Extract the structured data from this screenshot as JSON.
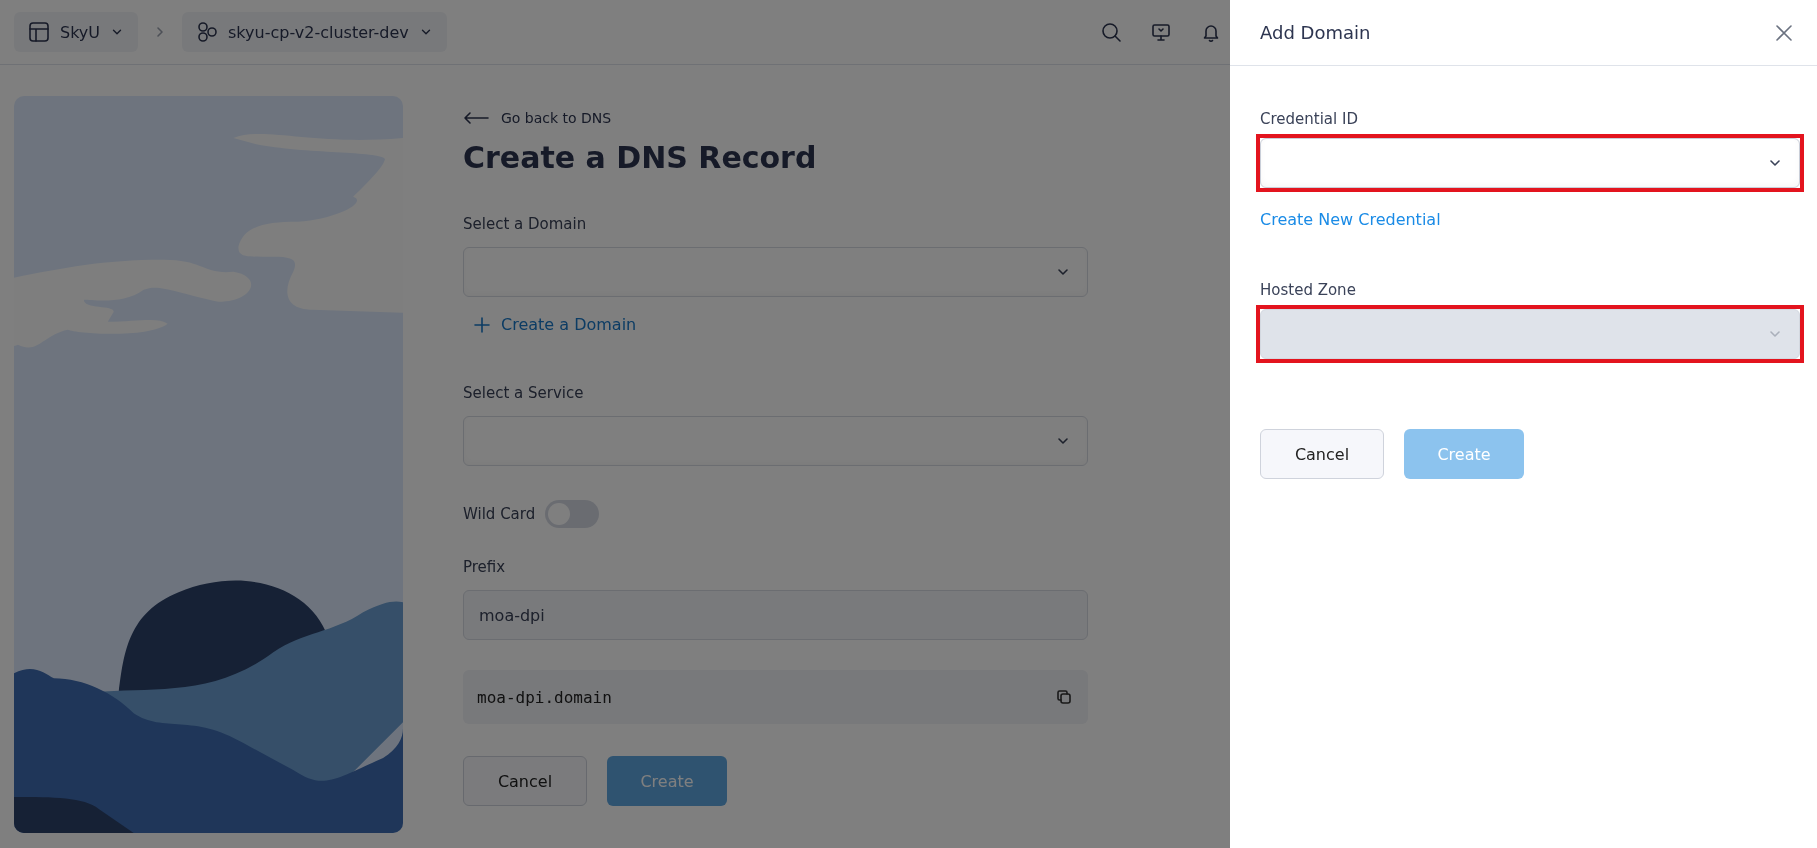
{
  "topbar": {
    "breadcrumbs": [
      {
        "label": "SkyU",
        "kind": "workspace"
      },
      {
        "label": "skyu-cp-v2-cluster-dev",
        "kind": "cluster"
      }
    ]
  },
  "form": {
    "back_link": "Go back to DNS",
    "title": "Create a DNS Record",
    "domain_select": {
      "label": "Select a Domain"
    },
    "create_domain_link": "Create a Domain",
    "service_select": {
      "label": "Select a Service"
    },
    "wildcard": {
      "label": "Wild Card",
      "on": false
    },
    "prefix": {
      "label": "Prefix",
      "value": "moa-dpi"
    },
    "full_domain": "moa-dpi.domain",
    "buttons": [
      {
        "label": "Cancel",
        "kind": "secondary",
        "disabled": false
      },
      {
        "label": "Create",
        "kind": "primary",
        "disabled": true
      }
    ]
  },
  "drawer": {
    "title": "Add Domain",
    "fields": [
      {
        "label": "Credential ID",
        "highlighted": true,
        "disabled": false,
        "link": "Create New Credential"
      },
      {
        "label": "Hosted Zone",
        "highlighted": true,
        "disabled": true
      }
    ],
    "buttons": [
      {
        "label": "Cancel",
        "kind": "secondary",
        "disabled": false
      },
      {
        "label": "Create",
        "kind": "primary",
        "disabled": true
      }
    ]
  }
}
